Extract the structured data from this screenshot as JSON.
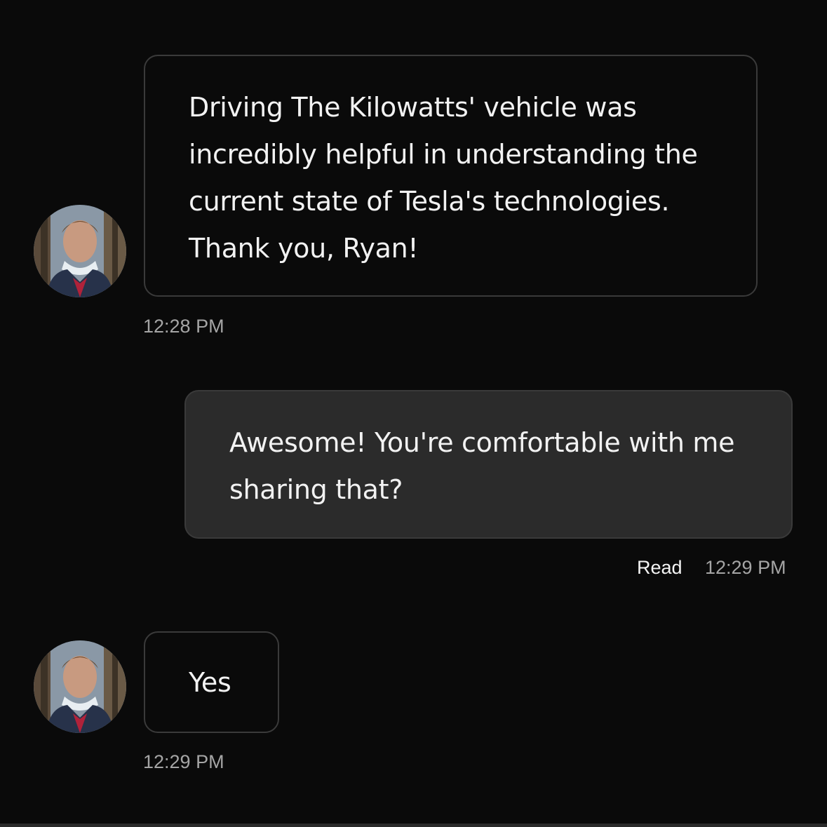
{
  "messages": [
    {
      "direction": "incoming",
      "text": "Driving The Kilowatts' vehicle was incredibly helpful in understanding the current state of Tesla's technologies. Thank you, Ryan!",
      "time": "12:28 PM"
    },
    {
      "direction": "outgoing",
      "text": "Awesome! You're comfortable with me sharing that?",
      "status": "Read",
      "time": "12:29 PM"
    },
    {
      "direction": "incoming",
      "text": "Yes",
      "time": "12:29 PM"
    }
  ],
  "colors": {
    "background": "#0a0a0a",
    "incoming_border": "#3a3a3a",
    "outgoing_bubble": "#2b2b2b",
    "timestamp": "#a5a5a5"
  },
  "icons": {
    "avatar": "profile-photo"
  }
}
